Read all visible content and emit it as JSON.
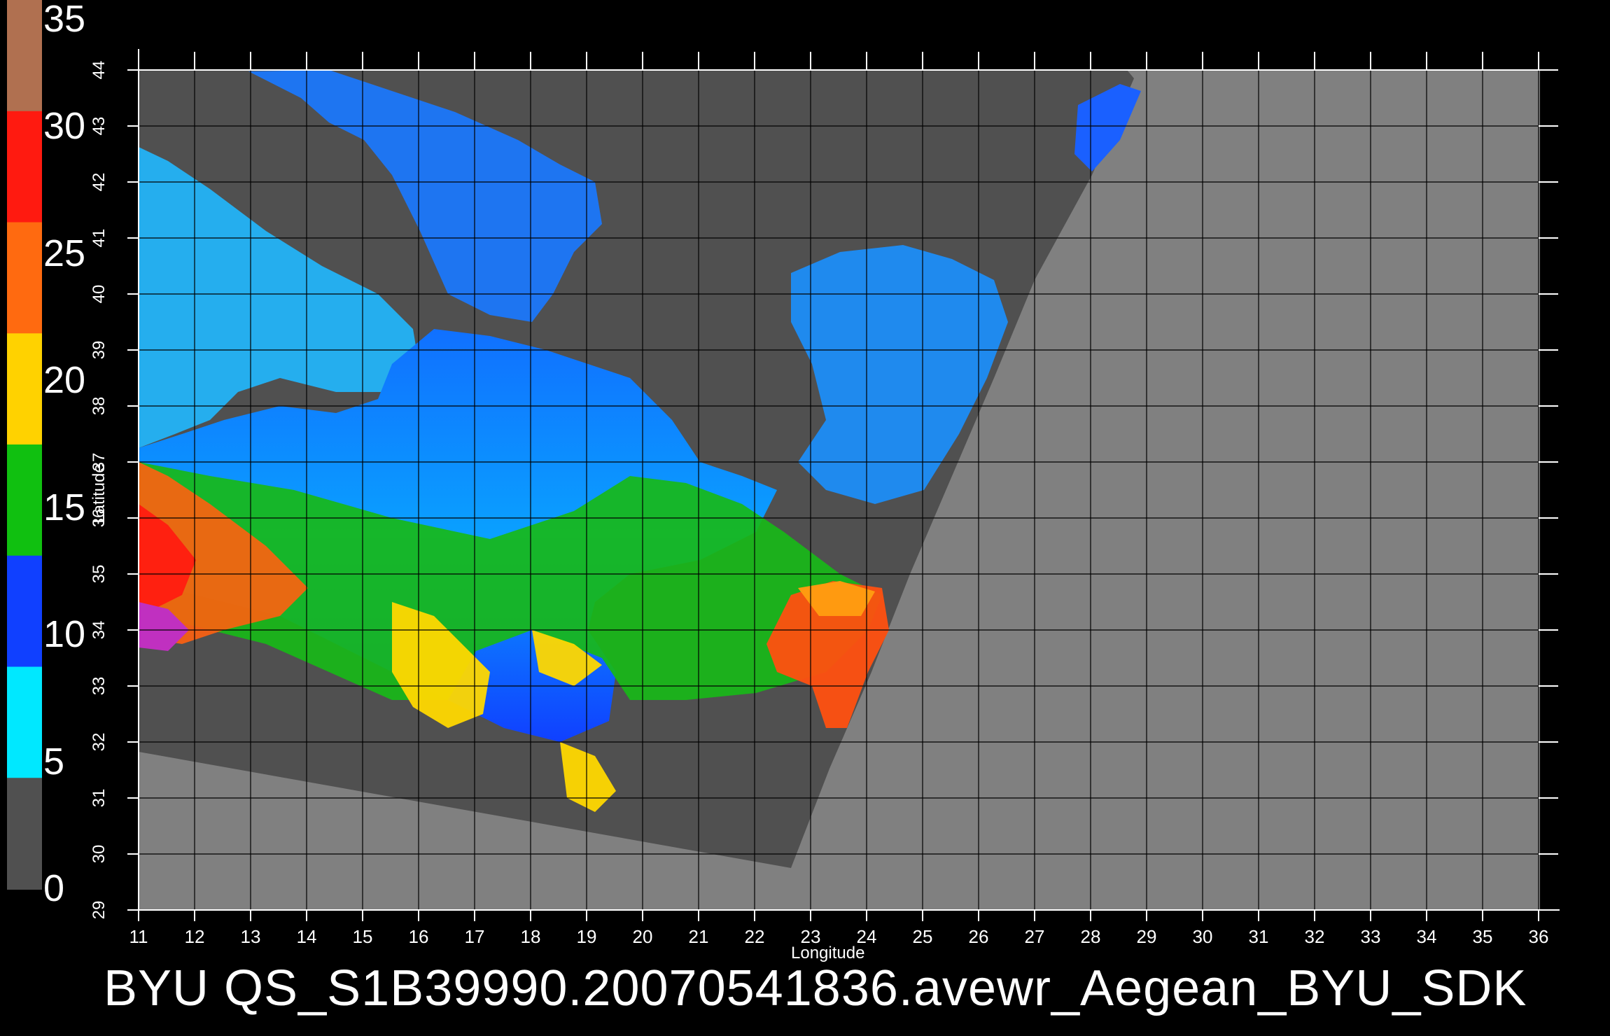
{
  "caption": "BYU  QS_S1B39990.20070541836.avewr_Aegean_BYU_SDK",
  "colorbar": {
    "labels": [
      "35",
      "30",
      "25",
      "20",
      "15",
      "10",
      "5",
      "0"
    ],
    "colors": [
      "#b07050",
      "#ff1a10",
      "#ff6a10",
      "#ffd200",
      "#10c010",
      "#1040ff",
      "#00e8ff",
      "#505050"
    ]
  },
  "axes": {
    "xlabel": "Longitude",
    "ylabel": "Latitude",
    "lon_ticks": [
      "11",
      "12",
      "13",
      "14",
      "15",
      "16",
      "17",
      "18",
      "19",
      "20",
      "21",
      "22",
      "23",
      "24",
      "25",
      "26",
      "27",
      "28",
      "29",
      "30",
      "31",
      "32",
      "33",
      "34",
      "35",
      "36"
    ],
    "lat_ticks": [
      "29",
      "30",
      "31",
      "32",
      "33",
      "34",
      "35",
      "36",
      "37",
      "38",
      "39",
      "40",
      "41",
      "42",
      "43",
      "44"
    ]
  },
  "colors": {
    "background": "#000000",
    "no_data": "#808080",
    "land": "#505050",
    "grid": "#000000"
  }
}
